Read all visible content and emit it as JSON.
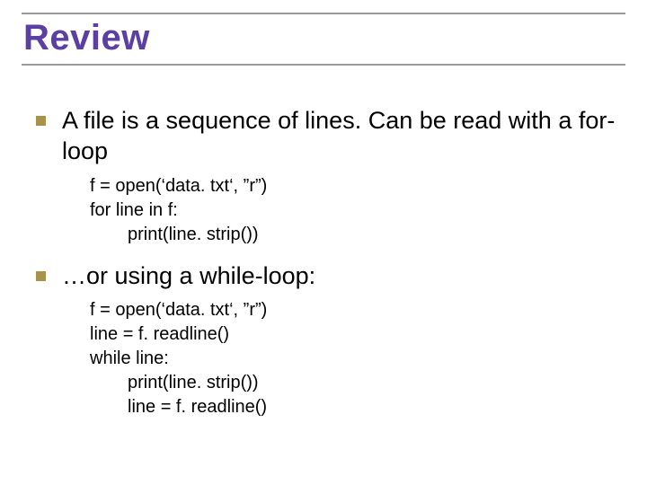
{
  "slide": {
    "title": "Review",
    "bullets": [
      {
        "text": "A file is a sequence of lines.  Can be read with a for-loop",
        "code": [
          "f = open(‘data. txt‘, ”r”)",
          "for line in f:",
          "print(line. strip())"
        ],
        "code_indent": [
          0,
          0,
          1
        ]
      },
      {
        "text": "…or using a while-loop:",
        "code": [
          "f = open(‘data. txt‘, ”r”)",
          "line = f. readline()",
          "while line:",
          "print(line. strip())",
          "line = f. readline()"
        ],
        "code_indent": [
          0,
          0,
          0,
          1,
          1
        ]
      }
    ]
  }
}
